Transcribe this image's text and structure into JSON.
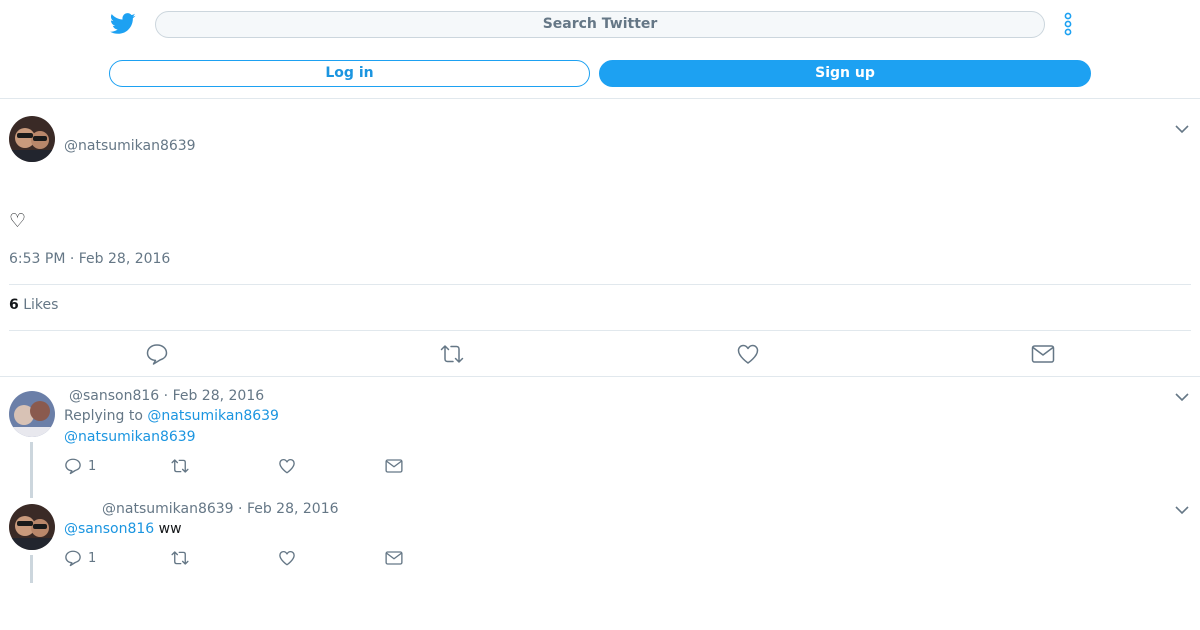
{
  "header": {
    "search_placeholder": "Search Twitter",
    "login_label": "Log in",
    "signup_label": "Sign up",
    "brand_color": "#1da1f2"
  },
  "main_tweet": {
    "handle": "@natsumikan8639",
    "text": "♡",
    "timestamp": "6:53 PM · Feb 28, 2016",
    "likes_count": "6",
    "likes_label": "Likes",
    "actions": [
      "reply-icon",
      "retweet-icon",
      "like-icon",
      "message-icon"
    ]
  },
  "replies": [
    {
      "handle": "@sanson816",
      "date": "Feb 28, 2016",
      "replying_to_label": "Replying to",
      "replying_to": "@natsumikan8639",
      "mention": "@natsumikan8639",
      "text": "",
      "reply_count": "1"
    },
    {
      "handle": "@natsumikan8639",
      "date": "Feb 28, 2016",
      "mention": "@sanson816",
      "text": "ww",
      "reply_count": "1"
    }
  ],
  "separator": "·"
}
